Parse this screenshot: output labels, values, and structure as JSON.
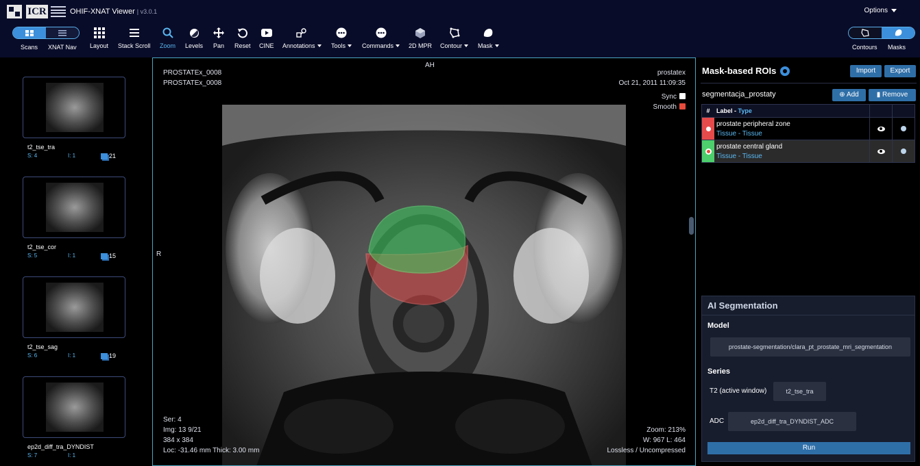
{
  "header": {
    "app_title": "OHIF-XNAT Viewer",
    "version": "| v3.0.1",
    "options_label": "Options"
  },
  "toolbar": {
    "scans_label": "Scans",
    "xnat_nav_label": "XNAT Nav",
    "tools": [
      {
        "label": "Layout",
        "icon": "grid-icon"
      },
      {
        "label": "Stack Scroll",
        "icon": "bars-icon"
      },
      {
        "label": "Zoom",
        "icon": "magnifier-icon",
        "active": true
      },
      {
        "label": "Levels",
        "icon": "contrast-icon"
      },
      {
        "label": "Pan",
        "icon": "move-icon"
      },
      {
        "label": "Reset",
        "icon": "reset-icon"
      },
      {
        "label": "CINE",
        "icon": "play-icon"
      },
      {
        "label": "Annotations",
        "icon": "annotations-icon",
        "dropdown": true
      },
      {
        "label": "Tools",
        "icon": "dots-icon",
        "dropdown": true
      },
      {
        "label": "Commands",
        "icon": "dots-icon",
        "dropdown": true
      },
      {
        "label": "2D MPR",
        "icon": "cube-icon"
      },
      {
        "label": "Contour",
        "icon": "contour-icon",
        "dropdown": true
      },
      {
        "label": "Mask",
        "icon": "mask-icon",
        "dropdown": true
      }
    ],
    "contours_label": "Contours",
    "masks_label": "Masks"
  },
  "series": [
    {
      "name": "t2_tse_tra",
      "s": "S: 4",
      "i": "I: 1",
      "count": "21"
    },
    {
      "name": "t2_tse_cor",
      "s": "S: 5",
      "i": "I: 1",
      "count": "15"
    },
    {
      "name": "t2_tse_sag",
      "s": "S: 6",
      "i": "I: 1",
      "count": "19"
    },
    {
      "name": "ep2d_diff_tra_DYNDIST",
      "s": "S: 7",
      "i": "I: 1",
      "count": ""
    }
  ],
  "viewport": {
    "top_left_1": "PROSTATEx_0008",
    "top_left_2": "PROSTATEx_0008",
    "top_center": "AH",
    "left_marker": "R",
    "top_right_1": "prostatex",
    "top_right_2": "Oct 21, 2011 11:09:35",
    "sync_label": "Sync",
    "smooth_label": "Smooth",
    "sync_checked": false,
    "smooth_checked": true,
    "bottom_left": [
      "Ser: 4",
      "Img: 13 9/21",
      "384 x 384",
      "Loc: -31.46 mm Thick: 3.00 mm"
    ],
    "bottom_right": [
      "Zoom: 213%",
      "W: 967 L: 464",
      "Lossless / Uncompressed"
    ]
  },
  "roi_panel": {
    "title": "Mask-based ROIs",
    "import_label": "Import",
    "export_label": "Export",
    "segmentation_name": "segmentacja_prostaty",
    "add_label": "Add",
    "remove_label": "Remove",
    "col_hash": "#",
    "col_label": "Label",
    "col_type": "Type",
    "rows": [
      {
        "label": "prostate peripheral zone",
        "type": "Tissue - Tissue",
        "color": "#e64b4b",
        "selected": false
      },
      {
        "label": "prostate central gland",
        "type": "Tissue - Tissue",
        "color": "#4ccf6c",
        "selected": true
      }
    ]
  },
  "ai_panel": {
    "title": "AI Segmentation",
    "model_heading": "Model",
    "model_value": "prostate-segmentation/clara_pt_prostate_mri_segmentation",
    "series_heading": "Series",
    "t2_label": "T2 (active window)",
    "t2_value": "t2_tse_tra",
    "adc_label": "ADC",
    "adc_value": "ep2d_diff_tra_DYNDIST_ADC",
    "run_label": "Run"
  }
}
